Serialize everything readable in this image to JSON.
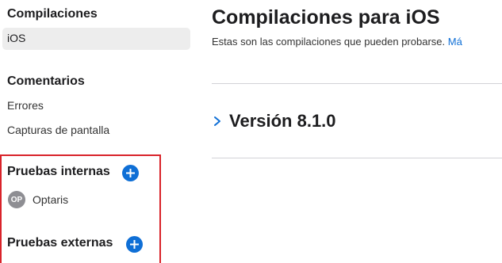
{
  "sidebar": {
    "builds": {
      "title": "Compilaciones",
      "items": [
        {
          "label": "iOS",
          "selected": true
        }
      ]
    },
    "feedback": {
      "title": "Comentarios",
      "items": [
        {
          "label": "Errores"
        },
        {
          "label": "Capturas de pantalla"
        }
      ]
    },
    "internal_testing": {
      "title": "Pruebas internas",
      "add_icon": "plus-circle-icon",
      "groups": [
        {
          "avatar": "OP",
          "label": "Optaris"
        }
      ]
    },
    "external_testing": {
      "title": "Pruebas externas",
      "add_icon": "plus-circle-icon"
    }
  },
  "main": {
    "title": "Compilaciones para iOS",
    "subtitle": "Estas son las compilaciones que pueden probarse.",
    "subtitle_link": "Má",
    "version": {
      "icon": "chevron-right-icon",
      "label": "Versión 8.1.0"
    }
  },
  "colors": {
    "accent": "#0f6fd6",
    "highlight": "#d9232a",
    "selected_bg": "#ededed",
    "avatar_bg": "#8e8e93"
  }
}
